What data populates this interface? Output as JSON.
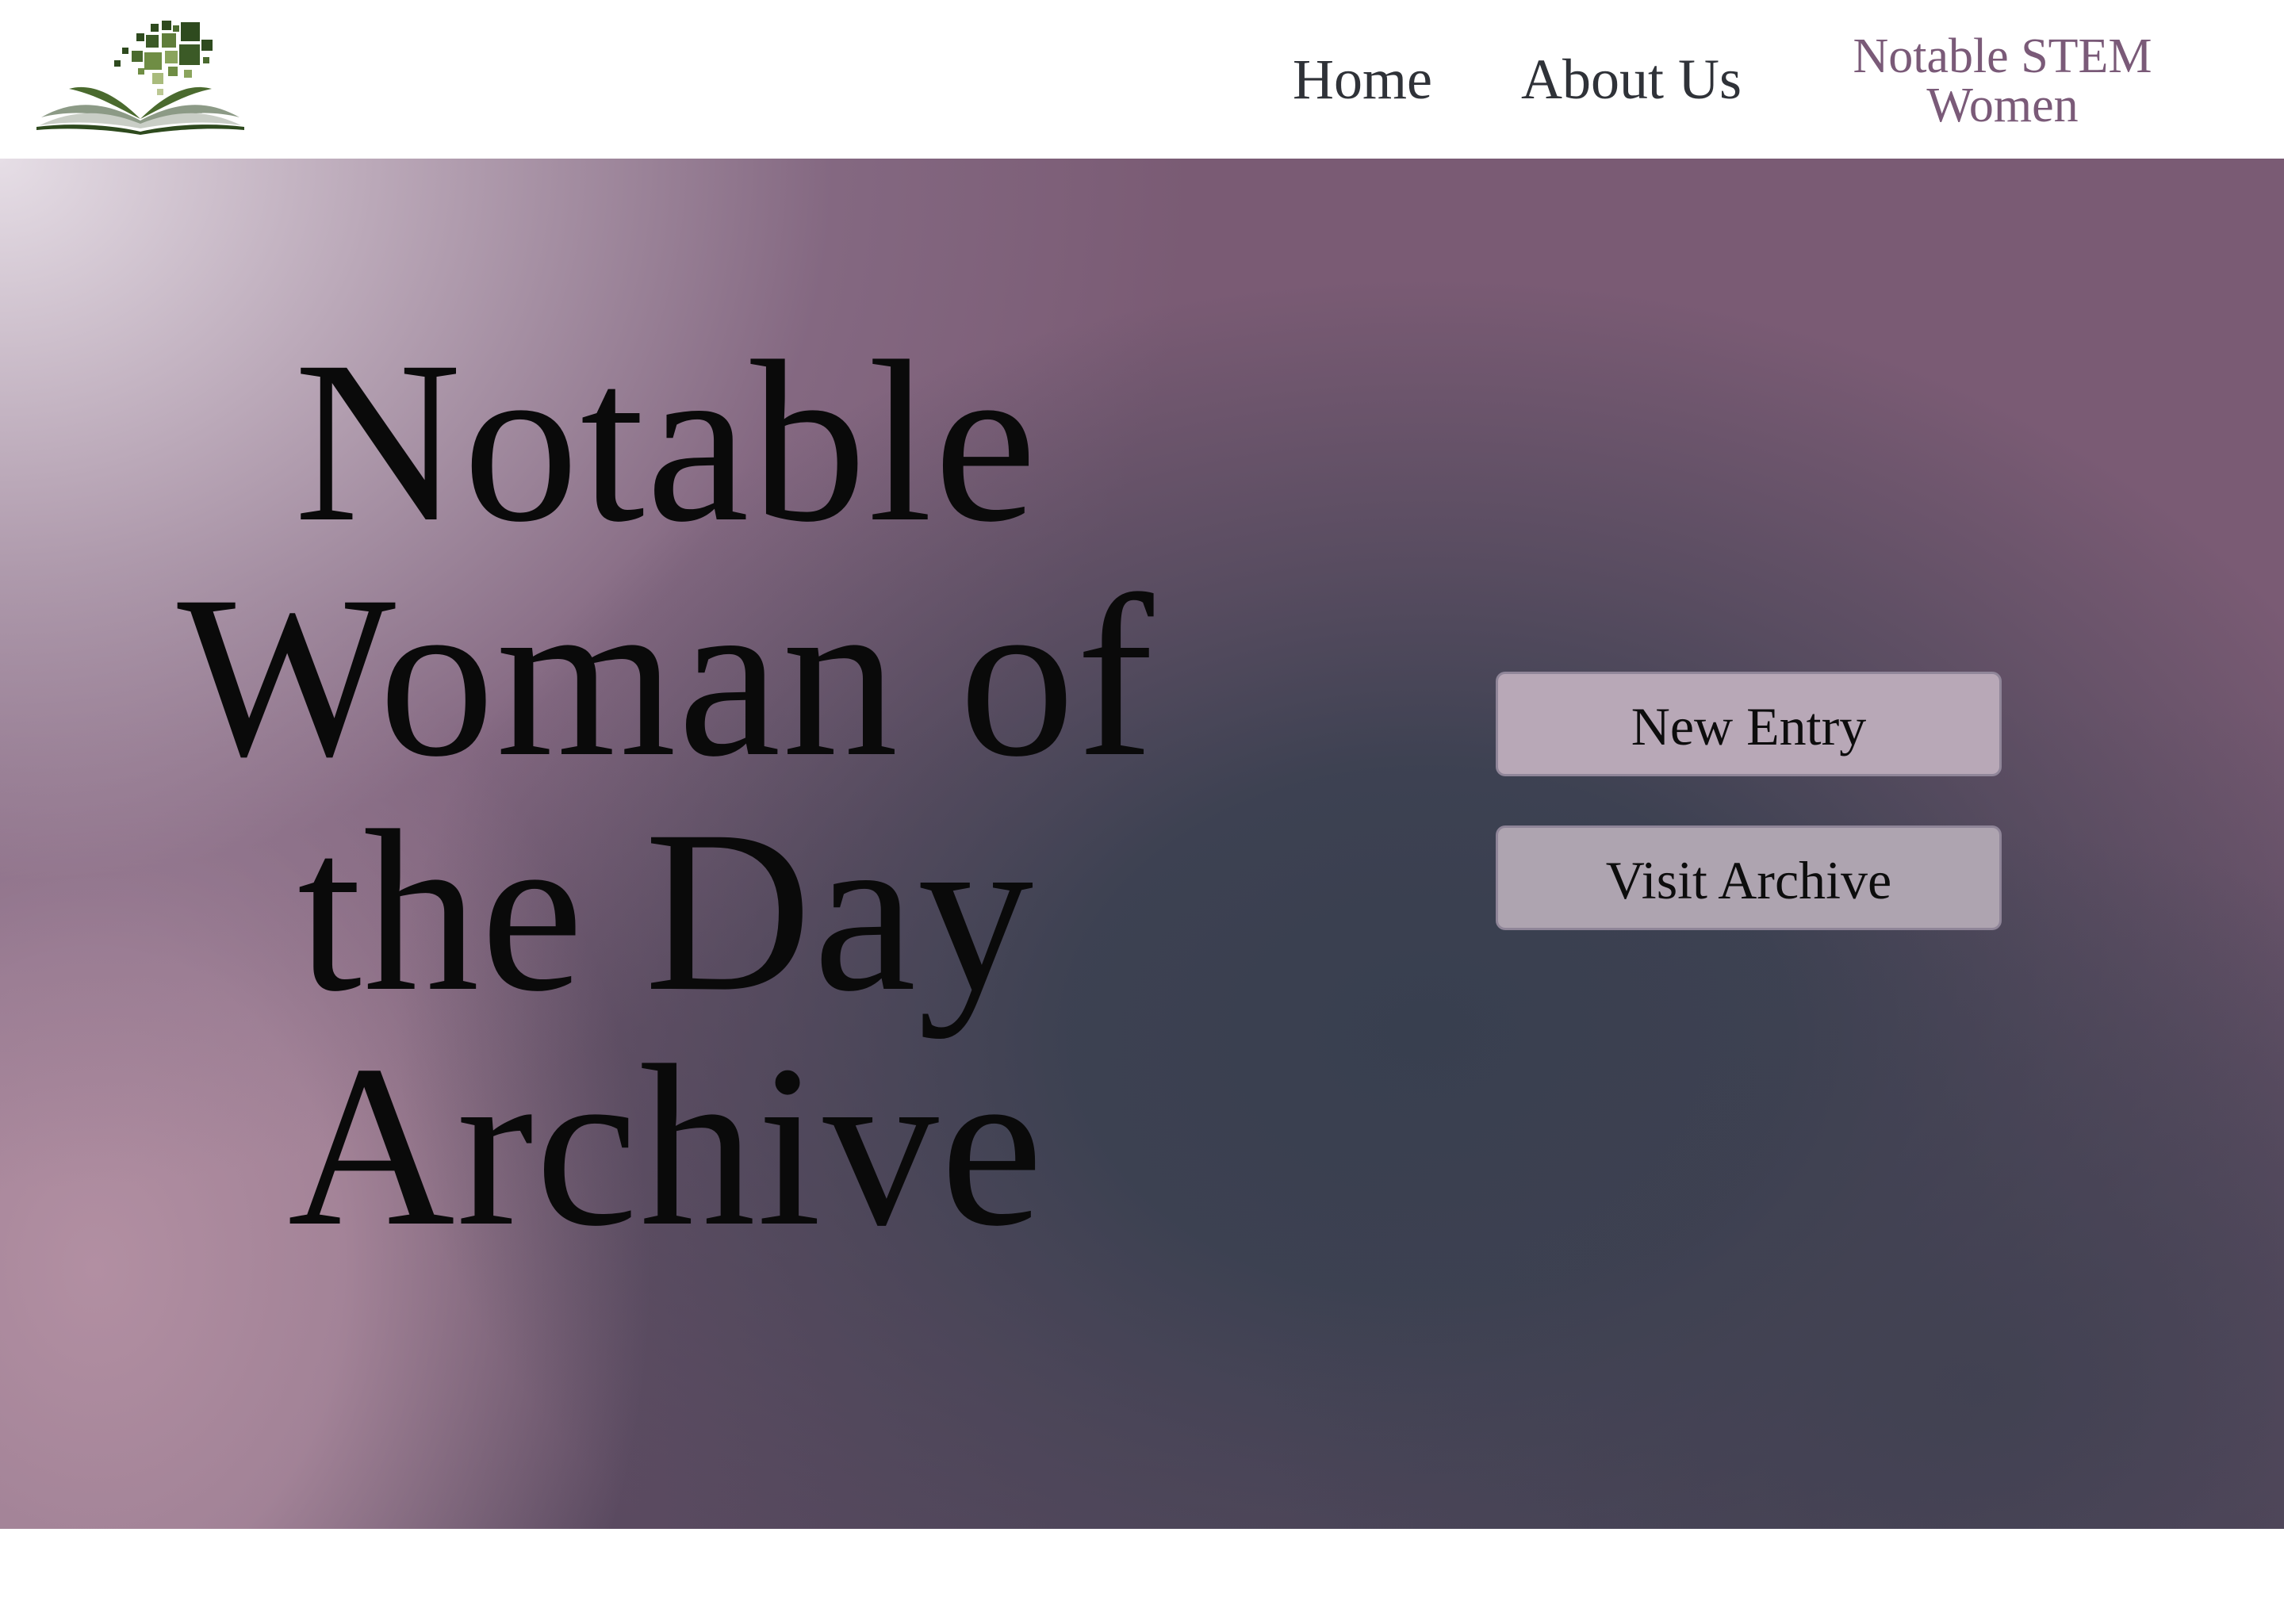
{
  "header": {
    "logo_icon": "open-book-with-pixel-squares-icon",
    "nav": {
      "home_label": "Home",
      "about_label": "About Us",
      "brand_line1": "Notable STEM",
      "brand_line2": "Women"
    }
  },
  "hero": {
    "title_lines": [
      "Notable",
      "Woman of",
      "the Day",
      "Archive"
    ],
    "buttons": {
      "new_entry_label": "New Entry",
      "visit_archive_label": "Visit Archive"
    }
  },
  "colors": {
    "brand_purple": "#7a5a78",
    "nav_text": "#2f3238",
    "hero_purple": "#7a5b74",
    "hero_slate": "#3d4051",
    "hero_pink": "#b18fa2",
    "button_fill": "#b8a8b7",
    "logo_green_dark": "#2e4a1e",
    "logo_green_light": "#7c9a4a"
  }
}
